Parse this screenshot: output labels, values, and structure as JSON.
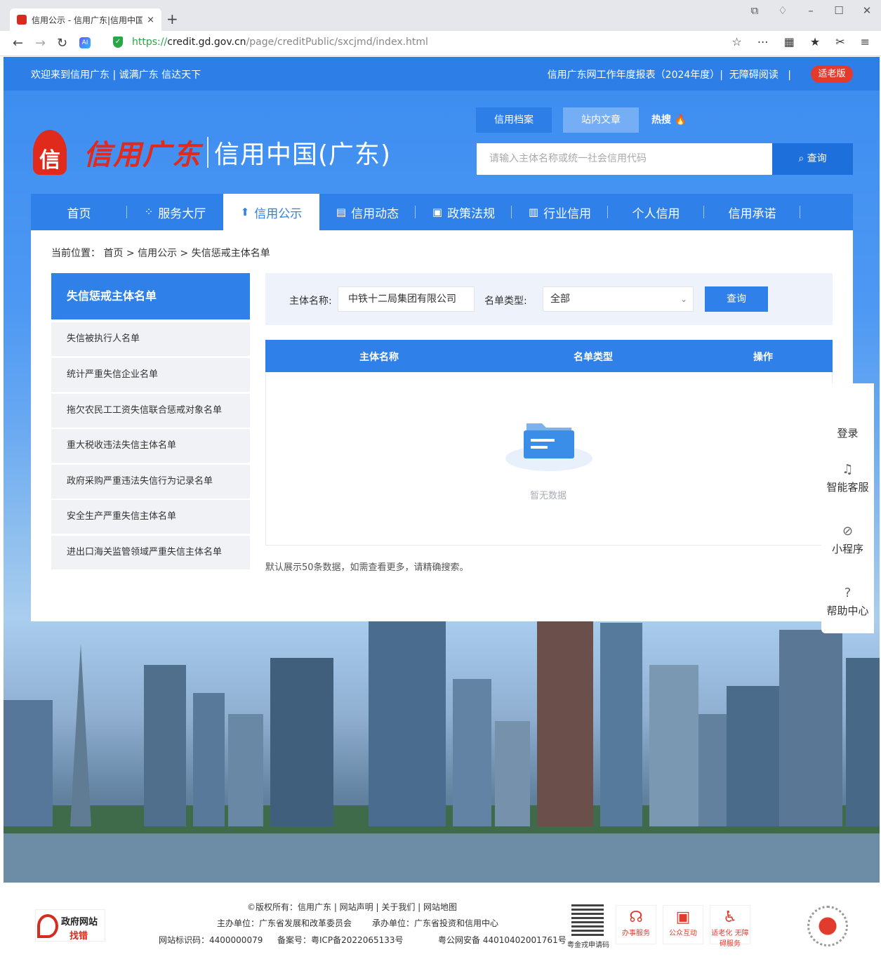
{
  "browser": {
    "tab_title": "信用公示 - 信用广东|信用中国(广东)",
    "tab_close": "×",
    "new_tab": "+",
    "url_proto": "https://",
    "url_host": "credit.gd.gov.cn",
    "url_path": "/page/creditPublic/sxcjmd/index.html",
    "win_controls": [
      "1",
      "ὄ5",
      "–",
      "☐",
      "✕"
    ]
  },
  "topbar": {
    "welcome": "欢迎来到信用广东 | 诚满广东 信达天下",
    "report": "信用广东网工作年度报表（2024年度）|",
    "accessible": "无障碍阅读",
    "divider": "|",
    "elder": "适老版"
  },
  "logo": {
    "script": "信用广东",
    "cn": "信用中国(广东)"
  },
  "search": {
    "tabs": [
      "信用档案",
      "站内文章",
      "热搜"
    ],
    "placeholder": "请输入主体名称或统一社会信用代码",
    "button": "查询"
  },
  "nav": {
    "items": [
      {
        "label": "首页",
        "icon": ""
      },
      {
        "label": "服务大厅",
        "icon": "apps-icon"
      },
      {
        "label": "信用公示",
        "icon": "announce-icon"
      },
      {
        "label": "信用动态",
        "icon": "news-icon"
      },
      {
        "label": "政策法规",
        "icon": "doc-icon"
      },
      {
        "label": "行业信用",
        "icon": "building-icon"
      },
      {
        "label": "个人信用",
        "icon": ""
      },
      {
        "label": "信用承诺",
        "icon": ""
      }
    ],
    "active_index": 2
  },
  "breadcrumb": "当前位置： 首页 > 信用公示 > 失信惩戒主体名单",
  "sidebar": {
    "title": "失信惩戒主体名单",
    "items": [
      "失信被执行人名单",
      "统计严重失信企业名单",
      "拖欠农民工工资失信联合惩戒对象名单",
      "重大税收违法失信主体名单",
      "政府采购严重违法失信行为记录名单",
      "安全生产严重失信主体名单",
      "进出口海关监管领域严重失信主体名单"
    ]
  },
  "filter": {
    "name_label": "主体名称:",
    "name_value": "中铁十二局集团有限公司",
    "type_label": "名单类型:",
    "type_value": "全部",
    "button": "查询"
  },
  "table": {
    "headers": [
      "主体名称",
      "名单类型",
      "操作"
    ],
    "rows": [],
    "empty_text": "暂无数据"
  },
  "note": "默认展示50条数据，如需查看更多，请精确搜索。",
  "float_tools": [
    "登录",
    "智能客服",
    "小程序",
    "帮助中心"
  ],
  "footer": {
    "gov_badge_1": "政府网站",
    "gov_badge_2": "找错",
    "line1": "©版权所有：信用广东 | 网站声明 | 关于我们 | 网站地图",
    "sponsor": "主办单位：广东省发展和改革委员会",
    "undertaker": "承办单位：广东省投资和信用中心",
    "site_id": "网站标识码：4400000079",
    "icp": "备案号：粤ICP备2022065133号",
    "psb": "粤公网安备 44010402001761号",
    "qr_label": "粤金戎申请码",
    "services": [
      "办事服务",
      "公众互动",
      "适老化 无障碍服务"
    ]
  }
}
